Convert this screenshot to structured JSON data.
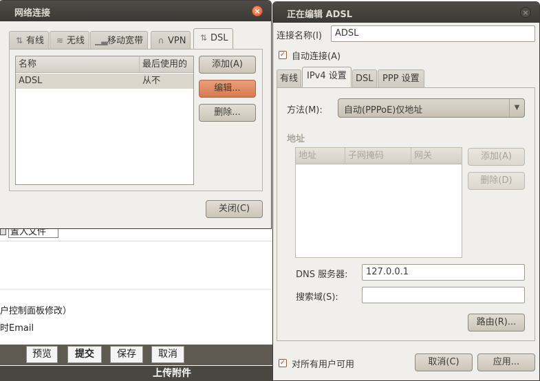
{
  "background_page": {
    "input_text": "置入文件",
    "hint_text": "户控制面板修改）",
    "email_text": "时Email",
    "buttons": [
      "预览",
      "提交",
      "保存",
      "取消"
    ],
    "upload_label": "上传附件"
  },
  "network_window": {
    "title": "网络连接",
    "tabs": [
      {
        "label": "有线",
        "icon": "wired-icon"
      },
      {
        "label": "无线",
        "icon": "wireless-icon"
      },
      {
        "label": "移动宽带",
        "icon": "mobile-broadband-icon"
      },
      {
        "label": "VPN",
        "icon": "vpn-lock-icon"
      },
      {
        "label": "DSL",
        "icon": "dsl-icon"
      }
    ],
    "active_tab": "DSL",
    "list": {
      "columns": [
        "名称",
        "最后使用的"
      ],
      "rows": [
        {
          "name": "ADSL",
          "last_used": "从不"
        }
      ]
    },
    "buttons": {
      "add": "添加(A)",
      "edit": "编辑...",
      "delete": "删除..."
    },
    "close_label": "关闭(C)",
    "colors": {
      "selected_button": "#d97a50",
      "titlebar": "#3c3b37"
    }
  },
  "edit_window": {
    "title": "正在编辑 ADSL",
    "connection_name_label": "连接名称(I)",
    "connection_name_value": "ADSL",
    "auto_connect_label": "自动连接(A)",
    "auto_connect_checked": true,
    "tabs": [
      "有线",
      "IPv4 设置",
      "DSL",
      "PPP 设置"
    ],
    "active_tab": "IPv4 设置",
    "method_label": "方法(M):",
    "method_value": "自动(PPPoE)仅地址",
    "address_section_label": "地址",
    "address_columns": [
      "地址",
      "子网掩码",
      "网关"
    ],
    "address_add": "添加(A)",
    "address_delete": "删除(D)",
    "dns_label": "DNS 服务器:",
    "dns_value": "127.0.0.1",
    "search_domain_label": "搜索域(S):",
    "search_domain_value": "",
    "routes_button": "路由(R)...",
    "all_users_label": "对所有用户可用",
    "all_users_checked": true,
    "cancel_button": "取消(C)",
    "apply_button": "应用..."
  }
}
